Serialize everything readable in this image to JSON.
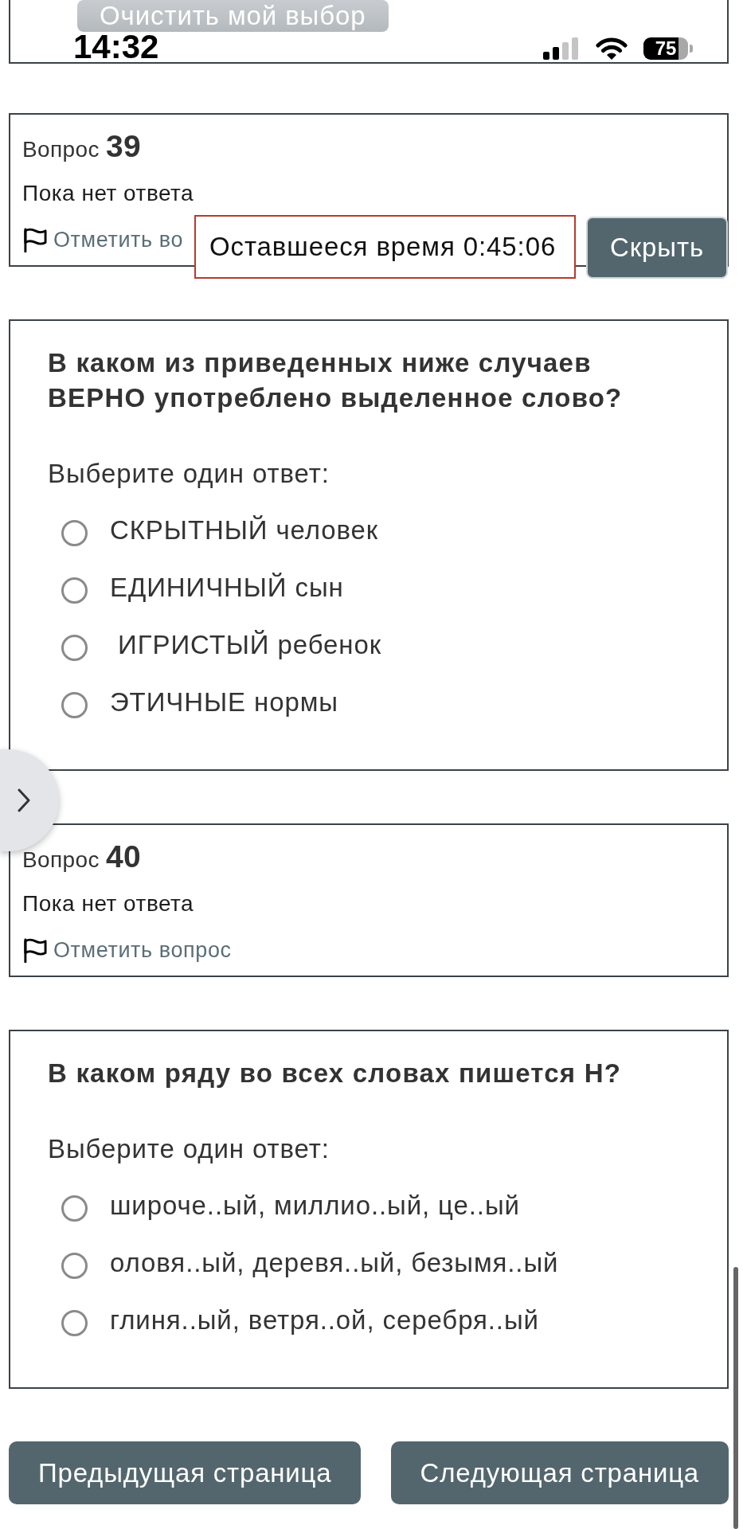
{
  "top_card": {
    "clear_button": {
      "label": "Очистить мой выбор",
      "disabled": true
    }
  },
  "status_bar": {
    "time": "14:32",
    "battery": "75"
  },
  "questions": [
    {
      "info": {
        "label": "Вопрос",
        "number": "39",
        "status": "Пока нет ответа",
        "flag_link": "Отметить во",
        "flagged": false
      },
      "text": "В каком из приведенных ниже случаев ВЕРНО употреблено выделенное слово?",
      "prompt": "Выберите один ответ:",
      "options": [
        {
          "text": "СКРЫТНЫЙ человек",
          "selected": false
        },
        {
          "text": "ЕДИНИЧНЫЙ сын",
          "selected": false
        },
        {
          "text": " ИГРИСТЫЙ ребенок",
          "selected": false
        },
        {
          "text": "ЭТИЧНЫЕ нормы",
          "selected": false
        }
      ]
    },
    {
      "info": {
        "label": "Вопрос",
        "number": "40",
        "status": "Пока нет ответа",
        "flag_link": "Отметить вопрос",
        "flagged": false
      },
      "text": "В каком ряду во всех словах пишется Н?",
      "prompt": "Выберите один ответ:",
      "options": [
        {
          "text": "широче..ый, миллио..ый, це..ый",
          "selected": false
        },
        {
          "text": "оловя..ый, деревя..ый, безымя..ый",
          "selected": false
        },
        {
          "text": "глиня..ый, ветря..ой, серебря..ый",
          "selected": false
        }
      ]
    }
  ],
  "timer": {
    "text": "Оставшееся время 0:45:06",
    "hide_button": "Скрыть"
  },
  "navigation": [
    {
      "label": "Предыдущая страница"
    },
    {
      "label": "Следующая страница"
    }
  ]
}
